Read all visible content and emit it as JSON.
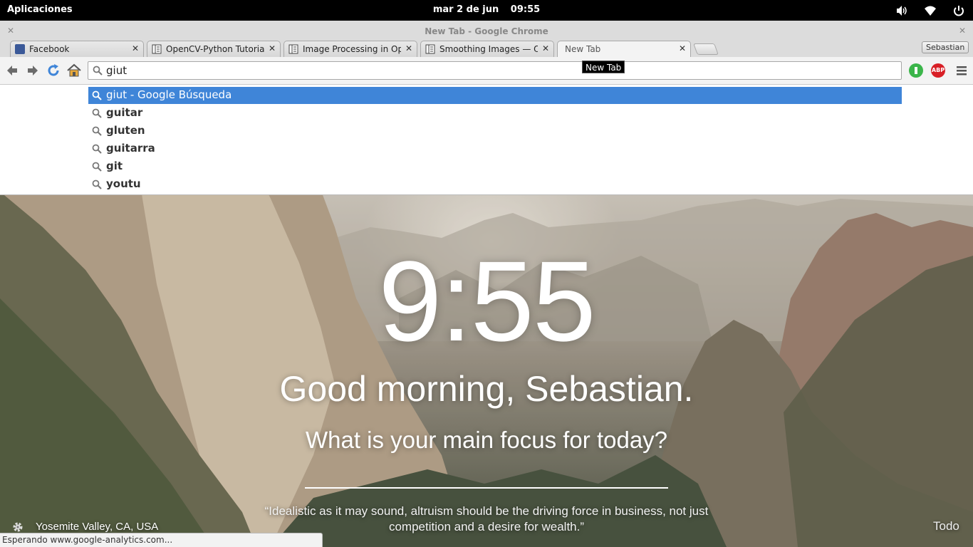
{
  "topbar": {
    "apps_label": "Aplicaciones",
    "date": "mar  2 de jun",
    "time": "09:55",
    "icons": [
      "volume-icon",
      "wifi-icon",
      "power-icon"
    ]
  },
  "window": {
    "title": "New Tab - Google Chrome"
  },
  "tabs": [
    {
      "label": "Facebook",
      "icon": "facebook-icon",
      "color": "#3b5998"
    },
    {
      "label": "OpenCV-Python Tutorials",
      "icon": "doc-icon",
      "color": "#444444"
    },
    {
      "label": "Image Processing in OpenCV",
      "icon": "doc-icon",
      "color": "#444444"
    },
    {
      "label": "Smoothing Images — OpenCV",
      "icon": "doc-icon",
      "color": "#444444"
    },
    {
      "label": "New Tab",
      "icon": "",
      "color": ""
    }
  ],
  "profile_name": "Sebastian",
  "omnibox": {
    "value": "giut",
    "tooltip": "New Tab"
  },
  "extensions": [
    {
      "name": "momentum-extension-icon",
      "label": "",
      "color": "#3bb54a"
    },
    {
      "name": "adblock-plus-icon",
      "label": "ABP",
      "color": "#d81f26"
    }
  ],
  "suggestions": [
    {
      "pre": "giut",
      "bold": "",
      "post": " - Google Búsqueda",
      "selected": true
    },
    {
      "pre": "",
      "bold": "guitar",
      "post": "",
      "selected": false
    },
    {
      "pre": "",
      "bold": "gluten",
      "post": "",
      "selected": false
    },
    {
      "pre": "",
      "bold": "guitarra",
      "post": "",
      "selected": false
    },
    {
      "pre": "",
      "bold": "git",
      "post": "",
      "selected": false
    },
    {
      "pre": "",
      "bold": "youtu",
      "post": "",
      "selected": false
    }
  ],
  "momentum": {
    "clock": "9:55",
    "greeting": "Good morning, Sebastian.",
    "focus_question": "What is your main focus for today?",
    "quote": "“Idealistic as it may sound, altruism should be the driving force in business, not just competition and a desire for wealth.”",
    "location": "Yosemite Valley, CA, USA",
    "todo": "Todo"
  },
  "status": "Esperando www.google-analytics.com...",
  "colors": {
    "selection": "#3f85d8",
    "topbar": "#000000",
    "chrome_frame": "#dcdcdc"
  }
}
